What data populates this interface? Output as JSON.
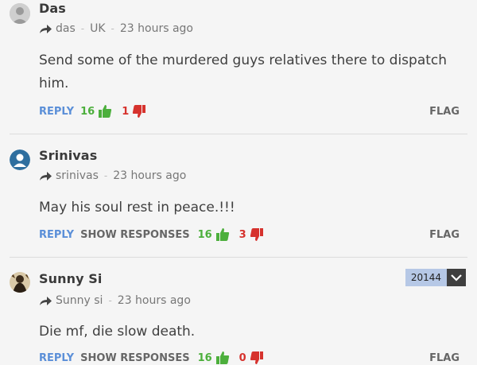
{
  "comments": [
    {
      "author": "Das",
      "handle": "das",
      "location": "UK",
      "time": "23 hours ago",
      "text": "Send some of the murdered guys relatives there to dispatch him.",
      "reply_label": "REPLY",
      "show_responses_label": "",
      "upvotes": "16",
      "downvotes": "1",
      "flag_label": "FLAG",
      "avatar": "default-user-icon"
    },
    {
      "author": "Srinivas",
      "handle": "srinivas",
      "time": "23 hours ago",
      "text": "May his soul rest in peace.!!!",
      "reply_label": "REPLY",
      "show_responses_label": "SHOW RESPONSES",
      "upvotes": "16",
      "downvotes": "3",
      "flag_label": "FLAG",
      "avatar": "user-circle-icon"
    },
    {
      "author": "Sunny Si",
      "handle": "Sunny si",
      "time": "23 hours ago",
      "text": "Die mf, die slow death.",
      "reply_label": "REPLY",
      "show_responses_label": "SHOW RESPONSES",
      "upvotes": "16",
      "downvotes": "0",
      "flag_label": "FLAG",
      "avatar": "photo-avatar",
      "badge": "20144"
    }
  ],
  "colors": {
    "reply": "#5b8fd8",
    "upvote": "#4caf3c",
    "downvote": "#d6322d",
    "badge_bg": "#b6c8e6"
  },
  "icons": {
    "share": "share-arrow-icon",
    "like": "thumbs-up-icon",
    "dislike": "thumbs-down-icon",
    "dropdown": "chevron-down-icon"
  }
}
